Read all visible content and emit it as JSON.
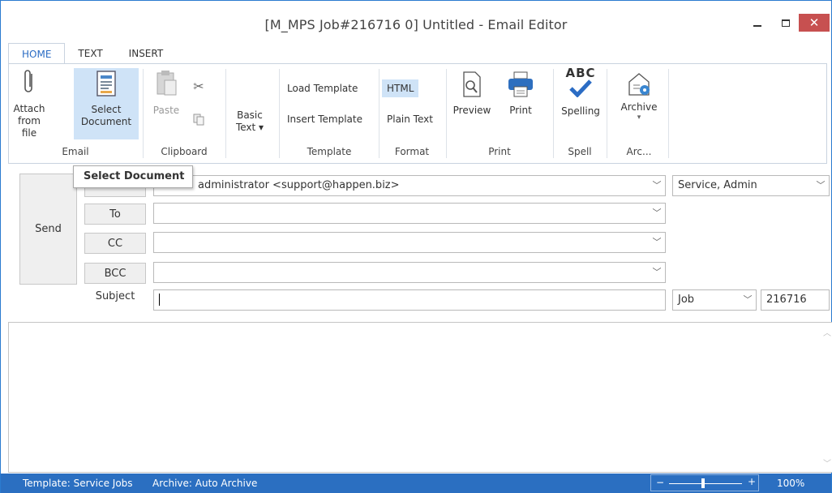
{
  "window": {
    "title": "[M_MPS Job#216716 0] Untitled - Email Editor"
  },
  "ribbon_tabs": [
    {
      "label": "HOME",
      "active": true
    },
    {
      "label": "TEXT",
      "active": false
    },
    {
      "label": "INSERT",
      "active": false
    }
  ],
  "ribbon": {
    "attach": "Attach\nfrom file",
    "select_document": "Select\nDocument",
    "paste": "Paste",
    "basic_text": "Basic\nText ▾",
    "load_template": "Load Template",
    "insert_template": "Insert Template",
    "html": "HTML",
    "plain_text": "Plain Text",
    "preview": "Preview",
    "print": "Print",
    "spelling": "Spelling",
    "spelling_icon_text": "ABC",
    "archive": "Archive",
    "archive_arrow": "▾",
    "groups": {
      "email": "Email",
      "clipboard": "Clipboard",
      "template": "Template",
      "format": "Format",
      "print": "Print",
      "spell": "Spell",
      "archive": "Arc..."
    }
  },
  "form": {
    "send": "Send",
    "from_value": "administrator <support@happen.biz>",
    "from_owner": "Service, Admin",
    "to_label": "To",
    "cc_label": "CC",
    "bcc_label": "BCC",
    "to_value": "",
    "cc_value": "",
    "bcc_value": "",
    "subject_label": "Subject",
    "subject_value": "",
    "job_type": "Job",
    "job_number": "216716"
  },
  "tooltip": "Select Document",
  "statusbar": {
    "template": "Template: Service Jobs",
    "archive": "Archive: Auto Archive",
    "zoom_minus": "−",
    "zoom_plus": "+",
    "zoom_percent": "100%"
  },
  "colors": {
    "accent": "#2b6fc1",
    "close": "#c75050",
    "selected": "#cfe3f7"
  }
}
